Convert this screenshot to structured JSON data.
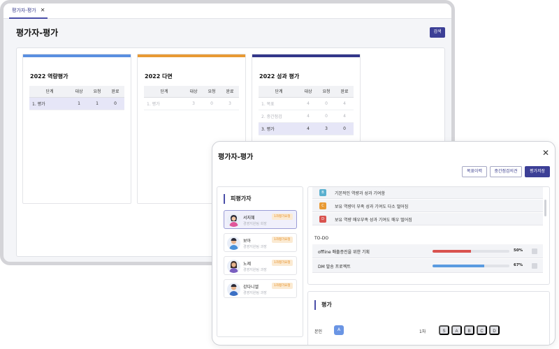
{
  "back": {
    "tab_label": "평가자-평가",
    "tab_close": "✕",
    "title": "평가자-평가",
    "search_label": "검색",
    "cards": [
      {
        "title": "2022 역량평가",
        "accent": "#5a8fe0",
        "headers": [
          "단계",
          "대상",
          "요청",
          "완료"
        ],
        "rows": [
          {
            "stage": "1.   평가",
            "target": "1",
            "request": "1",
            "done": "0",
            "state": "highlight"
          }
        ]
      },
      {
        "title": "2022 다면",
        "accent": "#e89a34",
        "headers": [
          "단계",
          "대상",
          "요청",
          "완료"
        ],
        "rows": [
          {
            "stage": "1.   평가",
            "target": "3",
            "request": "0",
            "done": "3",
            "state": "muted"
          }
        ]
      },
      {
        "title": "2022 성과 평가",
        "accent": "#33378a",
        "headers": [
          "단계",
          "대상",
          "요청",
          "완료"
        ],
        "rows": [
          {
            "stage": "1.   목표",
            "target": "4",
            "request": "0",
            "done": "4",
            "state": "muted"
          },
          {
            "stage": "2.   중간점검",
            "target": "4",
            "request": "0",
            "done": "4",
            "state": "muted"
          },
          {
            "stage": "3.   평가",
            "target": "4",
            "request": "3",
            "done": "0",
            "state": "highlight"
          }
        ]
      }
    ]
  },
  "modal": {
    "title": "평가자-평가",
    "close": "✕",
    "buttons": {
      "history": "목표이력",
      "midcheck": "중간점검의견",
      "save": "평가저장"
    },
    "evaluatee_header": "피평가자",
    "people": [
      {
        "name": "서지혜",
        "dept": "경영지원팀 회장",
        "badge": "1차평가요청",
        "selected": true
      },
      {
        "name": "보아",
        "dept": "경영지원팀 과장",
        "badge": "1차평가요청",
        "selected": false
      },
      {
        "name": "노제",
        "dept": "경영지원팀 과장",
        "badge": "1차평가요청",
        "selected": false
      },
      {
        "name": "강다니엘",
        "dept": "경영지원팀 과장",
        "badge": "1차평가요청",
        "selected": false
      }
    ],
    "grades": [
      {
        "letter": "B",
        "text": "기본적인 역량과 성과 기여함",
        "color": "#5ab0cf"
      },
      {
        "letter": "C",
        "text": "보유 역량이 부족 성과 기여도 다소 떨어짐",
        "color": "#e89a34"
      },
      {
        "letter": "D",
        "text": "보유 역량 매우부족 성과 기여도 매우 떨어짐",
        "color": "#d9534f"
      }
    ],
    "todo_title": "TO-DO",
    "todos": [
      {
        "name": "offline 매출증진을 위한 기획",
        "percent_label": "50%",
        "progress": 0.5,
        "color": "#d9534f"
      },
      {
        "name": "DM 발송 프로젝트",
        "percent_label": "67%",
        "progress": 0.67,
        "color": "#5a9be0"
      }
    ],
    "eval_header": "평가",
    "self_label": "본인",
    "self_grade": "A",
    "round_label": "1차",
    "grade_options": [
      "S",
      "A",
      "B",
      "C",
      "D"
    ]
  }
}
